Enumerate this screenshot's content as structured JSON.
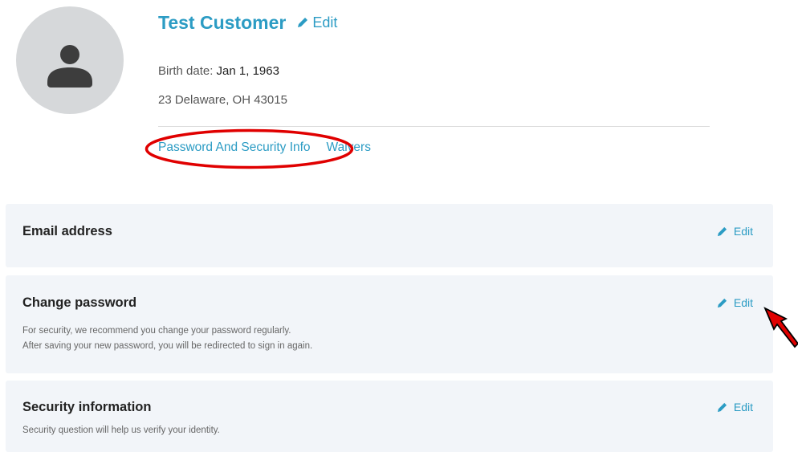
{
  "profile": {
    "name": "Test Customer",
    "edit_label": "Edit",
    "birth_label": "Birth date: ",
    "birth_value": "Jan 1, 1963",
    "address": "23 Delaware, OH 43015"
  },
  "links": {
    "password_security": "Password And Security Info",
    "waivers": "Waivers"
  },
  "panels": {
    "email": {
      "title": "Email address",
      "edit_label": "Edit"
    },
    "password": {
      "title": "Change password",
      "edit_label": "Edit",
      "desc_line1": "For security, we recommend you change your password regularly.",
      "desc_line2": "After saving your new password, you will be redirected to sign in again."
    },
    "security": {
      "title": "Security information",
      "edit_label": "Edit",
      "desc_line1": "Security question will help us verify your identity."
    }
  },
  "colors": {
    "accent": "#2c9cc4",
    "panel_bg": "#f2f5f9",
    "annotation": "#e00000"
  },
  "icons": [
    "user-avatar-icon",
    "pencil-icon"
  ]
}
